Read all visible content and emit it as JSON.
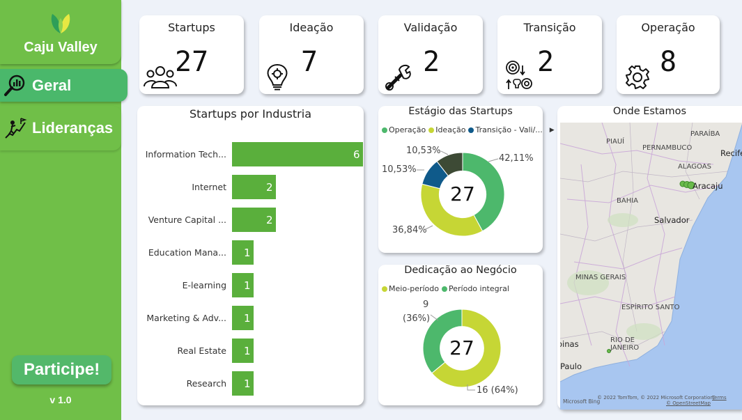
{
  "brand": {
    "name": "Caju Valley"
  },
  "nav": [
    {
      "label": "Geral",
      "active": true,
      "icon": "analytics-search-icon"
    },
    {
      "label": "Lideranças",
      "active": false,
      "icon": "climbing-leader-icon"
    }
  ],
  "participe_label": "Participe!",
  "version": "v 1.0",
  "kpis": [
    {
      "title": "Startups",
      "value": "27",
      "icon": "people-group-icon"
    },
    {
      "title": "Ideação",
      "value": "7",
      "icon": "lightbulb-gear-icon"
    },
    {
      "title": "Validação",
      "value": "2",
      "icon": "wrench-tools-icon"
    },
    {
      "title": "Transição",
      "value": "2",
      "icon": "transition-cycle-icon"
    },
    {
      "title": "Operação",
      "value": "8",
      "icon": "gear-icon"
    }
  ],
  "industry_chart": {
    "title": "Startups por Industria",
    "chart_data": {
      "type": "bar",
      "orientation": "horizontal",
      "categories": [
        "Information Tech...",
        "Internet",
        "Venture Capital ...",
        "Education Mana...",
        "E-learning",
        "Marketing & Adv...",
        "Real Estate",
        "Research"
      ],
      "values": [
        6,
        2,
        2,
        1,
        1,
        1,
        1,
        1
      ],
      "color": "#5aaf3c"
    }
  },
  "stage_chart": {
    "title": "Estágio das Startups",
    "legend": [
      {
        "label": "Operação",
        "color": "#4db86c"
      },
      {
        "label": "Ideação",
        "color": "#c6d635"
      },
      {
        "label": "Transição - Vali/...",
        "color": "#0f5a8a"
      }
    ],
    "center": "27",
    "chart_data": {
      "type": "pie",
      "donut": true,
      "slices": [
        {
          "label": "Operação",
          "value": 42.11,
          "text": "42,11%",
          "color": "#4db86c"
        },
        {
          "label": "Ideação",
          "value": 36.84,
          "text": "36,84%",
          "color": "#c6d635"
        },
        {
          "label": "Transição - Vali/...",
          "value": 10.53,
          "text": "10,53%",
          "color": "#0f5a8a"
        },
        {
          "label": "",
          "value": 10.53,
          "text": "10,53%",
          "color": "#3d4a35"
        }
      ]
    }
  },
  "dedication_chart": {
    "title": "Dedicação ao Negócio",
    "legend": [
      {
        "label": "Meio-período",
        "color": "#c6d635"
      },
      {
        "label": "Período integral",
        "color": "#4db86c"
      }
    ],
    "center": "27",
    "label_top_count": "9",
    "label_top_pct": "(36%)",
    "label_bottom": "16 (64%)",
    "chart_data": {
      "type": "pie",
      "donut": true,
      "slices": [
        {
          "label": "Meio-período",
          "value": 16,
          "color": "#c6d635"
        },
        {
          "label": "Período integral",
          "value": 9,
          "color": "#4db86c"
        }
      ]
    }
  },
  "map": {
    "title": "Onde Estamos",
    "labels": {
      "piaui": "PIAUÍ",
      "paraiba": "PARAÍBA",
      "pernambuco": "PERNAMBUCO",
      "recife": "Recife",
      "alagoas": "ALAGOAS",
      "aracaju": "Aracaju",
      "bahia": "BAHIA",
      "salvador": "Salvador",
      "minas": "MINAS GERAIS",
      "espirito": "ESPÍRITO SANTO",
      "rio": "RIO DE",
      "janeiro": "JANEIRO",
      "binas": "oinas",
      "paulo": "Paulo"
    },
    "credit": "© 2022 TomTom, © 2022 Microsoft Corporation,",
    "terms": "Terms",
    "osm": "© OpenStreetMap",
    "bing": "Microsoft Bing"
  }
}
